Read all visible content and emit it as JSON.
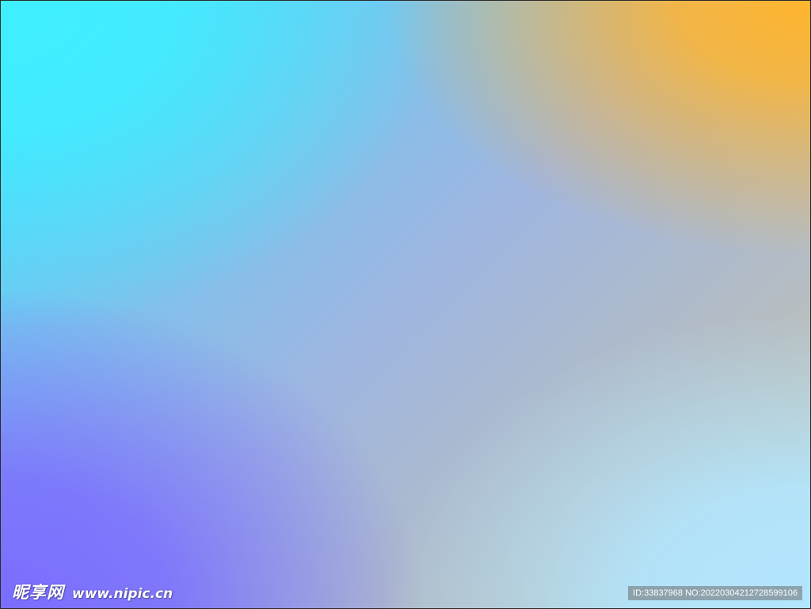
{
  "background": {
    "colors": {
      "top_left": "#3ef0ff",
      "top_right": "#ffb52e",
      "bottom_left": "#7a6dff",
      "bottom_right": "#b2e6ff"
    }
  },
  "watermark": {
    "brand": "昵享网",
    "url": "www.nipic.cn"
  },
  "id_strip": {
    "text": "ID:33837968 NO:20220304212728599106"
  }
}
